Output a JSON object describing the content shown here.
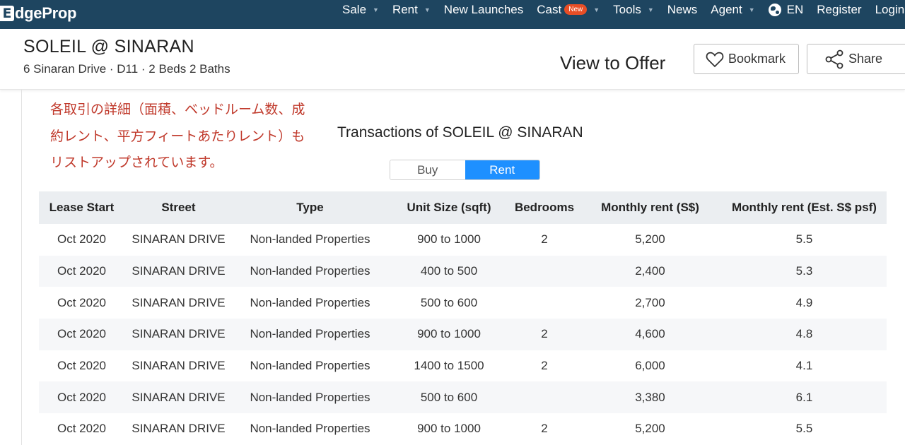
{
  "nav": {
    "logo_mark": "E",
    "logo_text": "dgeProp",
    "items": [
      {
        "label": "Sale",
        "has_caret": true,
        "badge": ""
      },
      {
        "label": "Rent",
        "has_caret": true,
        "badge": ""
      },
      {
        "label": "New Launches",
        "has_caret": false,
        "badge": ""
      },
      {
        "label": "Cast",
        "has_caret": true,
        "badge": "New"
      },
      {
        "label": "Tools",
        "has_caret": true,
        "badge": ""
      },
      {
        "label": "News",
        "has_caret": false,
        "badge": ""
      },
      {
        "label": "Agent",
        "has_caret": true,
        "badge": ""
      }
    ],
    "language": "EN",
    "register": "Register",
    "login": "Login"
  },
  "header": {
    "title": "SOLEIL @ SINARAN",
    "subtitle": "6 Sinaran Drive · D11 · 2 Beds 2 Baths",
    "price": "View to Offer",
    "bookmark_label": "Bookmark",
    "share_label": "Share"
  },
  "note": "各取引の詳細（面積、ベッドルーム数、成約レント、平方フィートあたりレント）もリストアップされています。",
  "transactions": {
    "title": "Transactions of SOLEIL @ SINARAN",
    "toggle": {
      "buy": "Buy",
      "rent": "Rent",
      "selected": "rent"
    },
    "columns": [
      "Lease Start",
      "Street",
      "Type",
      "Unit Size (sqft)",
      "Bedrooms",
      "Monthly rent (S$)",
      "Monthly rent (Est. S$ psf)"
    ],
    "rows": [
      [
        "Oct 2020",
        "SINARAN DRIVE",
        "Non-landed Properties",
        "900 to 1000",
        "2",
        "5,200",
        "5.5"
      ],
      [
        "Oct 2020",
        "SINARAN DRIVE",
        "Non-landed Properties",
        "400 to 500",
        "",
        "2,400",
        "5.3"
      ],
      [
        "Oct 2020",
        "SINARAN DRIVE",
        "Non-landed Properties",
        "500 to 600",
        "",
        "2,700",
        "4.9"
      ],
      [
        "Oct 2020",
        "SINARAN DRIVE",
        "Non-landed Properties",
        "900 to 1000",
        "2",
        "4,600",
        "4.8"
      ],
      [
        "Oct 2020",
        "SINARAN DRIVE",
        "Non-landed Properties",
        "1400 to 1500",
        "2",
        "6,000",
        "4.1"
      ],
      [
        "Oct 2020",
        "SINARAN DRIVE",
        "Non-landed Properties",
        "500 to 600",
        "",
        "3,380",
        "6.1"
      ],
      [
        "Oct 2020",
        "SINARAN DRIVE",
        "Non-landed Properties",
        "900 to 1000",
        "2",
        "5,200",
        "5.5"
      ]
    ]
  },
  "colors": {
    "nav_bg": "#1e4560",
    "accent": "#1e90ff",
    "badge": "#e84e26",
    "note_text": "#c0392b"
  },
  "icons": {
    "globe": "globe-icon",
    "bookmark": "heart-icon",
    "share": "share-icon",
    "caret": "chevron-down-icon"
  }
}
